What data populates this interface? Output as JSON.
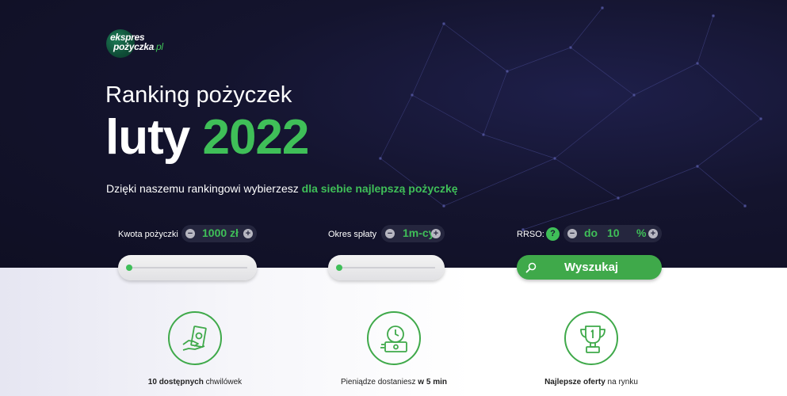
{
  "logo": {
    "line1": "ekspres",
    "line2": "pożyczka",
    "line2_suffix": ".pl"
  },
  "hero": {
    "title_line1": "Ranking pożyczek",
    "title_month": "luty",
    "title_year": "2022",
    "subtitle_text": "Dzięki naszemu rankingowi wybierzesz ",
    "subtitle_highlight": "dla siebie najlepszą pożyczkę"
  },
  "form": {
    "amount": {
      "label": "Kwota pożyczki",
      "value": "1000",
      "unit": "zł",
      "minus": "−",
      "plus": "+",
      "slider_level": 0
    },
    "period": {
      "label": "Okres spłaty",
      "value": "1m-cy",
      "minus": "−",
      "plus": "+",
      "slider_level": 0
    },
    "rrso": {
      "label": "RRSO:",
      "help": "?",
      "prefix": "do",
      "value": "10",
      "unit": "%",
      "minus": "−",
      "plus": "+"
    },
    "search_label": "Wyszukaj"
  },
  "features": [
    {
      "icon": "money-hand-icon",
      "bold": "10 dostępnych",
      "rest": " chwilówek"
    },
    {
      "icon": "clock-money-icon",
      "text": "Pieniądze dostaniesz ",
      "bold": "w 5 min"
    },
    {
      "icon": "trophy-icon",
      "bold": "Najlepsze oferty",
      "rest": " na rynku"
    }
  ],
  "colors": {
    "accent": "#3fbf58",
    "hero_bg": "#0f0f23",
    "button": "#3fa94a"
  }
}
